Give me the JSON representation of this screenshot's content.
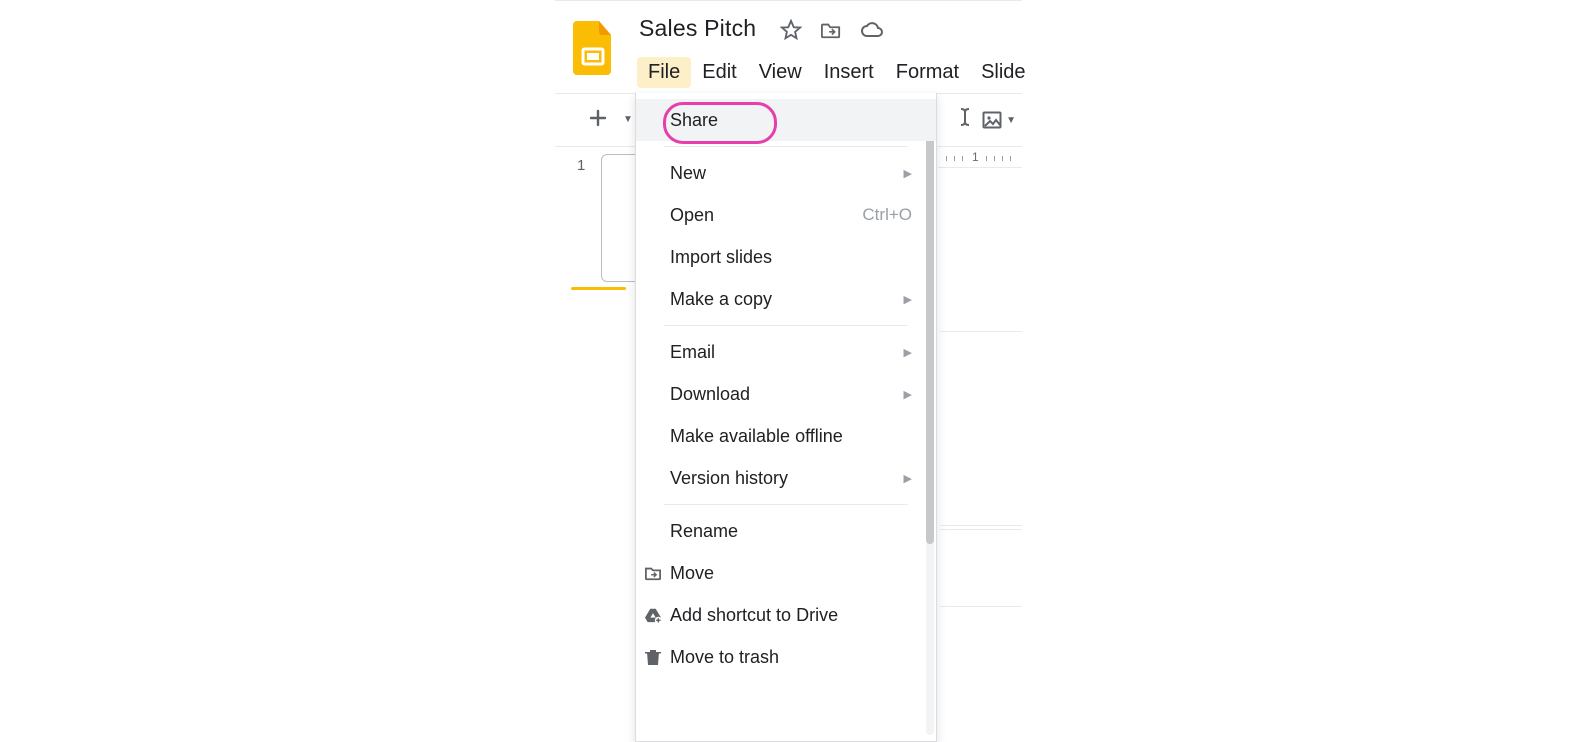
{
  "document": {
    "title": "Sales Pitch"
  },
  "menubar": {
    "items": [
      "File",
      "Edit",
      "View",
      "Insert",
      "Format",
      "Slide"
    ],
    "active_index": 0
  },
  "slide_panel": {
    "current_number": "1"
  },
  "ruler": {
    "mark": "1"
  },
  "file_menu": {
    "share": {
      "label": "Share"
    },
    "new": {
      "label": "New",
      "submenu": true
    },
    "open": {
      "label": "Open",
      "shortcut": "Ctrl+O"
    },
    "import_slides": {
      "label": "Import slides"
    },
    "make_a_copy": {
      "label": "Make a copy",
      "submenu": true
    },
    "email": {
      "label": "Email",
      "submenu": true
    },
    "download": {
      "label": "Download",
      "submenu": true
    },
    "offline": {
      "label": "Make available offline"
    },
    "version_history": {
      "label": "Version history",
      "submenu": true
    },
    "rename": {
      "label": "Rename"
    },
    "move": {
      "label": "Move",
      "icon": "move"
    },
    "add_shortcut": {
      "label": "Add shortcut to Drive",
      "icon": "drive"
    },
    "move_to_trash": {
      "label": "Move to trash",
      "icon": "trash"
    }
  }
}
